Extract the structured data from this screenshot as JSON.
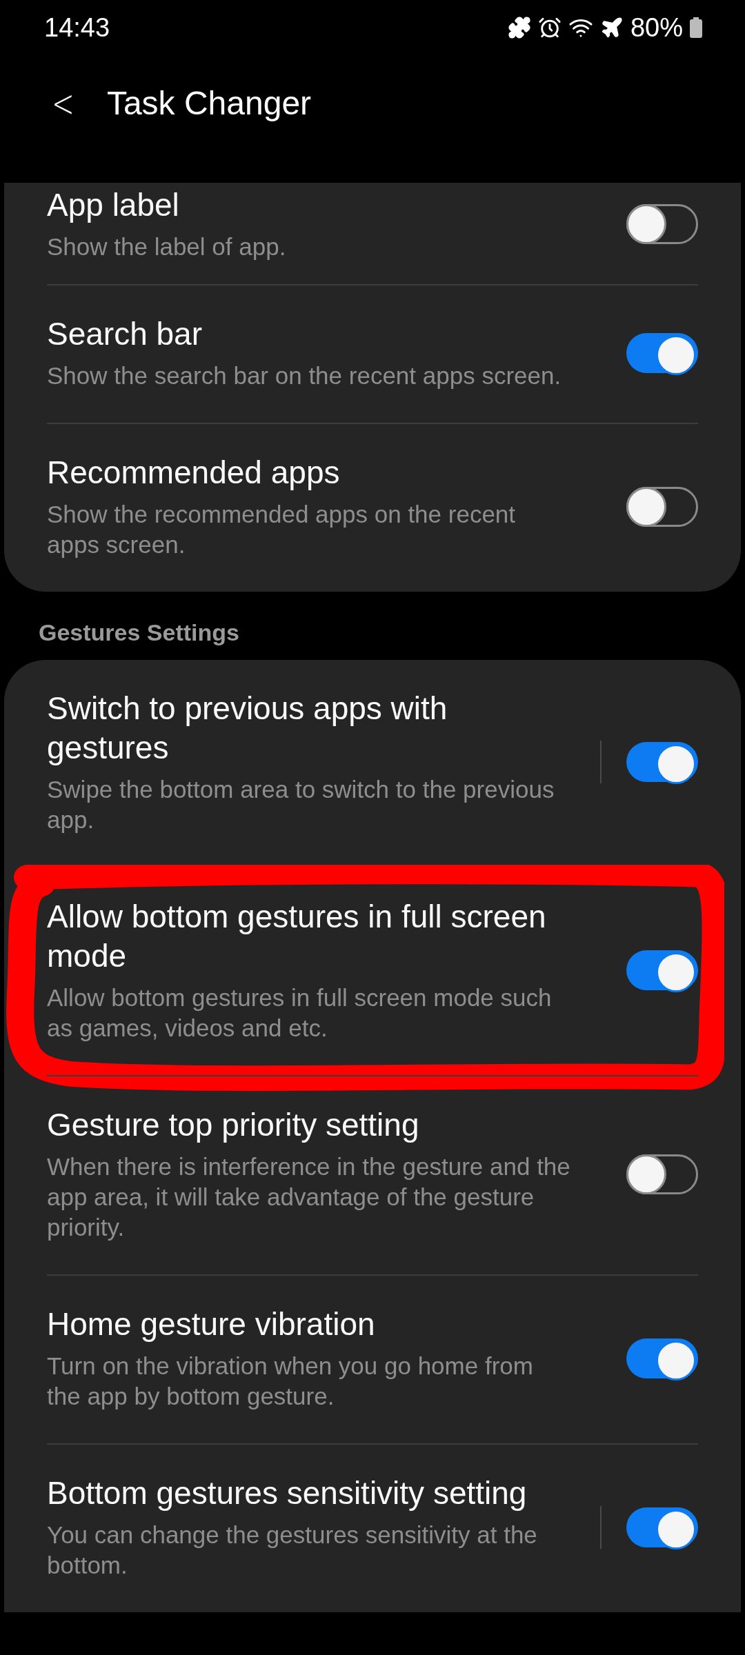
{
  "status_bar": {
    "time": "14:43",
    "battery": "80%"
  },
  "header": {
    "back": "<",
    "title": "Task Changer"
  },
  "cards": [
    {
      "items": [
        {
          "title": "App label",
          "subtitle": "Show the label of app.",
          "on": false,
          "split": false,
          "highlighted": false
        },
        {
          "title": "Search bar",
          "subtitle": "Show the search bar on the recent apps screen.",
          "on": true,
          "split": false,
          "highlighted": false
        },
        {
          "title": "Recommended apps",
          "subtitle": "Show the recommended apps on the recent apps screen.",
          "on": false,
          "split": false,
          "highlighted": false
        }
      ]
    },
    {
      "section": "Gestures Settings",
      "items": [
        {
          "title": "Switch to previous apps with gestures",
          "subtitle": "Swipe the bottom area to switch to the previous app.",
          "on": true,
          "split": true,
          "highlighted": false
        },
        {
          "title": "Allow bottom gestures in full screen mode",
          "subtitle": "Allow bottom gestures in full screen mode such as games, videos and etc.",
          "on": true,
          "split": false,
          "highlighted": true
        },
        {
          "title": "Gesture top priority setting",
          "subtitle": "When there is interference in the gesture and the app area, it will take advantage of the gesture priority.",
          "on": false,
          "split": false,
          "highlighted": false
        },
        {
          "title": "Home gesture vibration",
          "subtitle": "Turn on the vibration when you go home from the app by bottom gesture.",
          "on": true,
          "split": false,
          "highlighted": false
        },
        {
          "title": "Bottom gestures sensitivity setting",
          "subtitle": "You can change the gestures sensitivity at the bottom.",
          "on": true,
          "split": true,
          "highlighted": false
        }
      ]
    }
  ]
}
